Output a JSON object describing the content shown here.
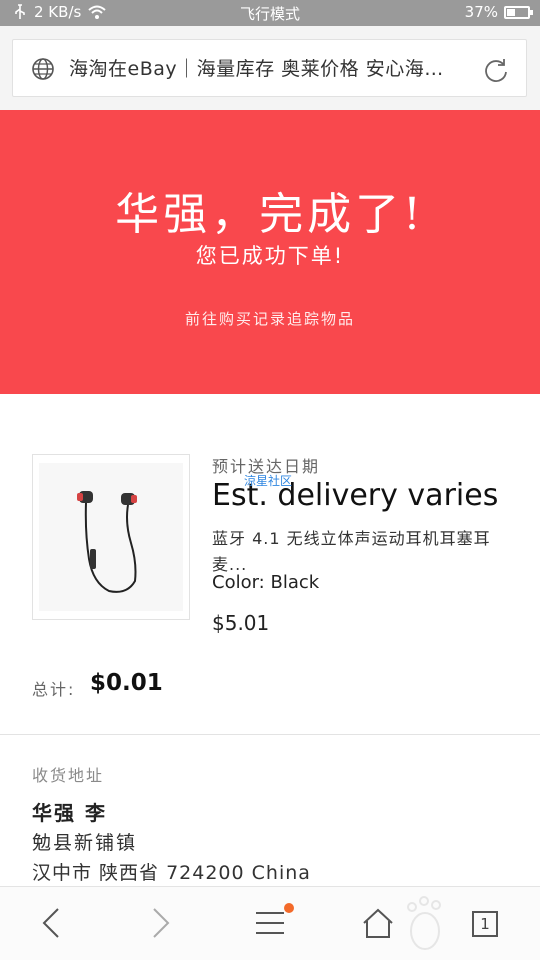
{
  "status_bar": {
    "network_speed": "2 KB/s",
    "mode": "飞行模式",
    "battery": "37%",
    "icons": [
      "usb-icon",
      "wifi-icon",
      "battery-icon"
    ]
  },
  "address_bar": {
    "title": "海淘在eBay｜海量库存 奥莱价格 安心海…",
    "icons": [
      "globe-icon",
      "refresh-icon"
    ]
  },
  "hero": {
    "background_color": "#f9484d",
    "title": "华强，完成了!",
    "subtitle": "您已成功下单!",
    "link": "前往购买记录追踪物品"
  },
  "order_item": {
    "delivery_label": "预计送达日期",
    "delivery_value": "Est. delivery varies",
    "watermark": "涼星社区",
    "title_line1": "蓝牙 4.1 无线立体声运动耳机耳塞耳",
    "title_line2": "麦...",
    "color": "Color: Black",
    "price": "$5.01",
    "image_icon": "earphones-icon"
  },
  "total": {
    "label": "总计:",
    "value": "$0.01"
  },
  "shipping_address": {
    "label": "收货地址",
    "name": "华强 李",
    "line1": "勉县新铺镇",
    "line2": "汉中市 陕西省 724200 China"
  },
  "toolbar": {
    "items": [
      "back-icon",
      "forward-icon",
      "menu-icon",
      "home-icon",
      "tabs-icon"
    ],
    "tab_count": "1",
    "badge_color": "#f36a2a"
  }
}
